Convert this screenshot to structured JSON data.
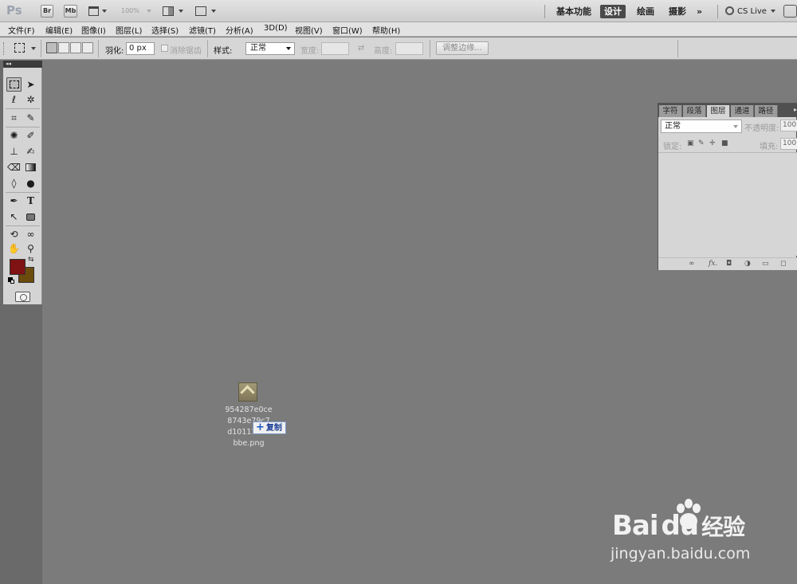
{
  "app": {
    "logo": "Ps",
    "bridge_label": "Br",
    "minibridge_label": "Mb",
    "zoom": "100%",
    "workspaces": [
      "基本功能",
      "设计",
      "绘画",
      "摄影"
    ],
    "active_workspace": "设计",
    "more_label": "»",
    "cs_live": "CS Live"
  },
  "menu": [
    "文件(F)",
    "编辑(E)",
    "图像(I)",
    "图层(L)",
    "选择(S)",
    "滤镜(T)",
    "分析(A)",
    "3D(D)",
    "视图(V)",
    "窗口(W)",
    "帮助(H)"
  ],
  "options": {
    "feather_label": "羽化:",
    "feather_value": "0 px",
    "antialias_label": "消除锯齿",
    "style_label": "样式:",
    "style_value": "正常",
    "width_label": "宽度:",
    "height_label": "高度:",
    "swap_icon": "⇄",
    "refine_label": "调整边缘..."
  },
  "toolbox": {
    "header": "◂◂",
    "foreground_color": "#7f1212",
    "background_color": "#6c4c0c"
  },
  "layers_panel": {
    "tabs": [
      "字符",
      "段落",
      "图层",
      "通道",
      "路径"
    ],
    "active_tab": "图层",
    "blend_mode": "正常",
    "opacity_label": "不透明度:",
    "opacity_value": "100",
    "lock_label": "锁定:",
    "fill_label": "填充:",
    "fill_value": "100"
  },
  "drag": {
    "filename_lines": [
      "954287e0ce",
      "8743e79c7",
      "d10111c69",
      "bbe.png"
    ],
    "tooltip": "复制"
  },
  "watermark": {
    "brand": "Bai",
    "brand2": "du",
    "cn": "经验",
    "url": "jingyan.baidu.com"
  }
}
